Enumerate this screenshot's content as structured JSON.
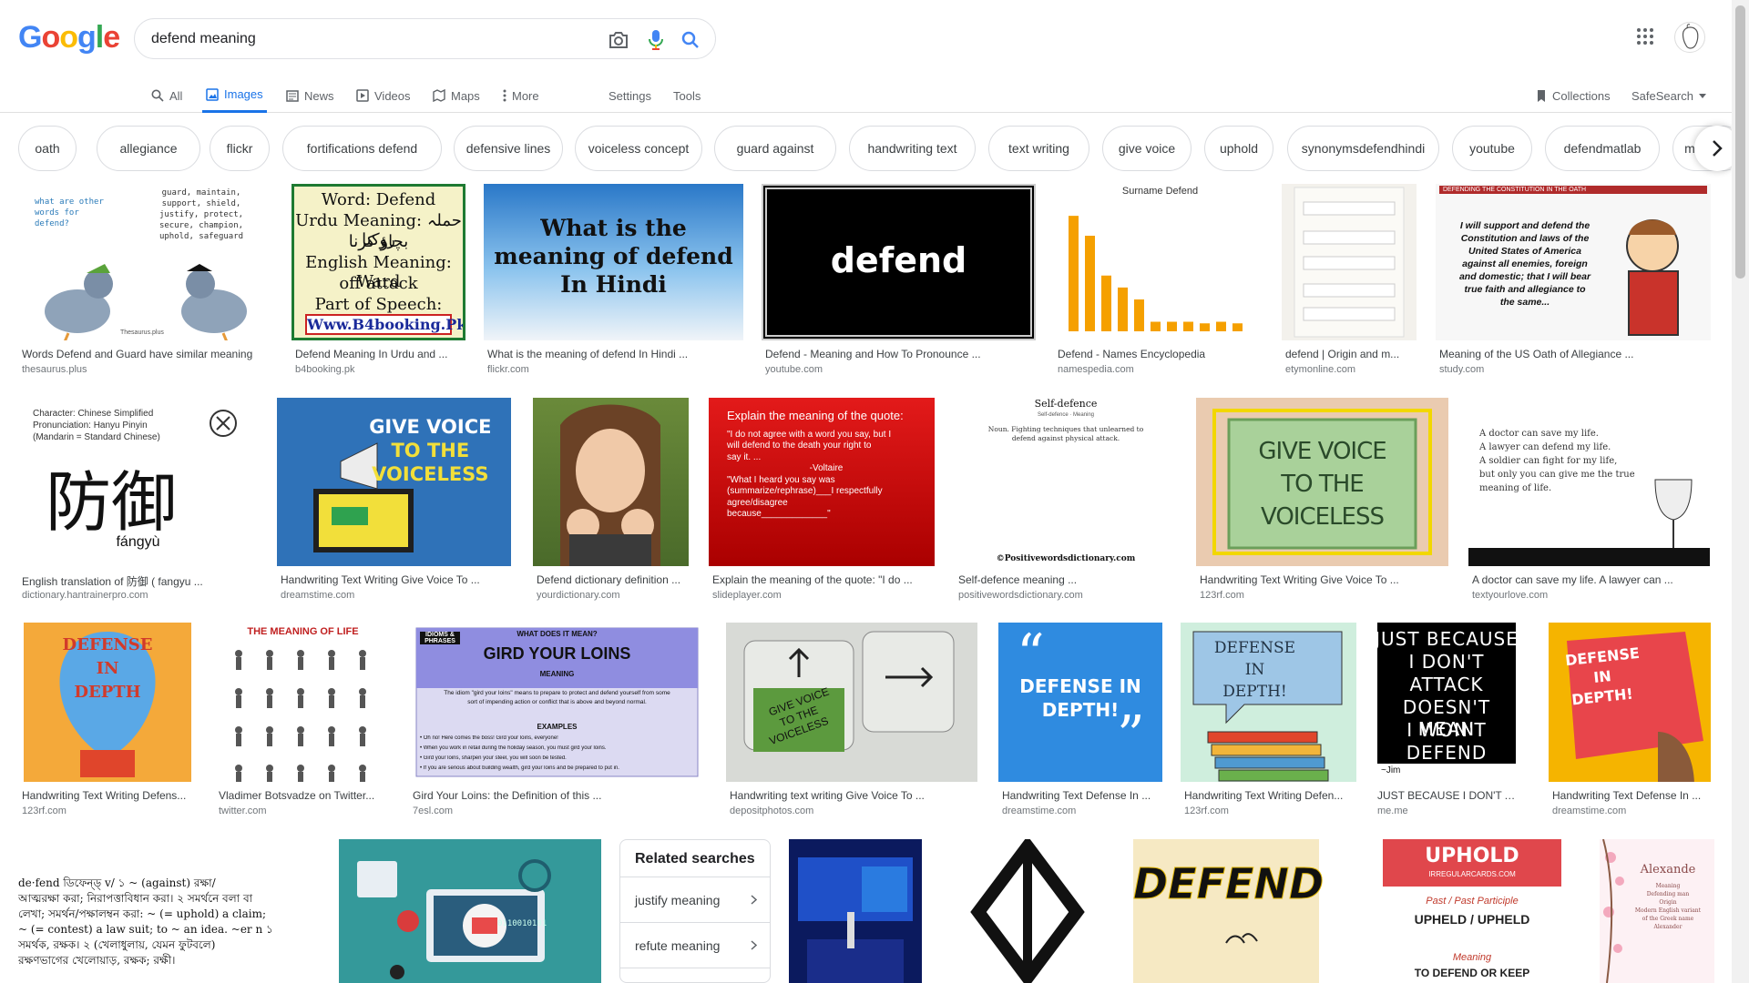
{
  "logo_text": [
    "G",
    "o",
    "o",
    "g",
    "l",
    "e"
  ],
  "logo_colors": [
    "#4285F4",
    "#EA4335",
    "#FBBC05",
    "#4285F4",
    "#34A853",
    "#EA4335"
  ],
  "search": {
    "query": "defend meaning"
  },
  "tabs": {
    "all": "All",
    "images": "Images",
    "news": "News",
    "videos": "Videos",
    "maps": "Maps",
    "more": "More",
    "settings": "Settings",
    "tools": "Tools",
    "collections": "Collections",
    "safesearch": "SafeSearch"
  },
  "chips": [
    "oath",
    "allegiance",
    "flickr",
    "fortifications defend",
    "defensive lines",
    "voiceless concept",
    "guard against",
    "handwriting text",
    "text writing",
    "give voice",
    "uphold",
    "synonymsdefendhindi",
    "youtube",
    "defendmatlab",
    "meaning"
  ],
  "results_row1": [
    {
      "caption": "Words Defend and Guard have similar meaning",
      "domain": "thesaurus.plus",
      "art": "pigeons",
      "img_text": "what are other words for defend?",
      "img_text2": "guard, maintain, support, shield, justify, protect, secure, champion, uphold, safeguard",
      "img_text3": "Thesaurus.plus"
    },
    {
      "caption": "Defend Meaning In Urdu and ...",
      "domain": "b4booking.pk",
      "art": "urdu",
      "lines": [
        "Word: Defend",
        "Urdu Meaning: حملہ روکنا",
        "بچاؤ کرنا",
        "English Meaning: Ward",
        "off attack",
        "Part of Speech: Verb",
        "Www.B4booking.Pk"
      ]
    },
    {
      "caption": "What is the meaning of defend In Hindi ...",
      "domain": "flickr.com",
      "art": "sky",
      "lines": [
        "What is the",
        "meaning of defend",
        "In Hindi"
      ]
    },
    {
      "caption": "Defend - Meaning and How To Pronounce ...",
      "domain": "youtube.com",
      "art": "black",
      "lines": [
        "defend"
      ]
    },
    {
      "caption": "Defend - Names Encyclopedia",
      "domain": "namespedia.com",
      "art": "bars",
      "img_text": "Surname Defend"
    },
    {
      "caption": "defend | Origin and m...",
      "domain": "etymonline.com",
      "art": "phone"
    },
    {
      "caption": "Meaning of the US Oath of Allegiance ...",
      "domain": "study.com",
      "art": "oath",
      "img_text": "DEFENDING THE CONSTITUTION IN THE OATH",
      "lines": [
        "I will support and defend the",
        "Constitution and laws of the",
        "United States of America",
        "against all enemies, foreign",
        "and domestic; that I will bear",
        "true faith and allegiance to",
        "the same..."
      ]
    }
  ],
  "results_row2": [
    {
      "caption": "English translation of 防御 ( fangyu ...",
      "domain": "dictionary.hantrainerpro.com",
      "art": "chinese",
      "lines": [
        "Character: Chinese Simplified",
        "Pronunciation: Hanyu Pinyin",
        "(Mandarin = Standard Chinese)",
        "防御",
        "fángyù"
      ]
    },
    {
      "caption": "Handwriting Text Writing Give Voice To ...",
      "domain": "dreamstime.com",
      "art": "voice-blue",
      "lines": [
        "GIVE VOICE",
        "TO THE",
        "VOICELESS"
      ]
    },
    {
      "caption": "Defend dictionary definition ...",
      "domain": "yourdictionary.com",
      "art": "girl"
    },
    {
      "caption": "Explain the meaning of the quote: \"I do ...",
      "domain": "slideplayer.com",
      "art": "red",
      "lines": [
        "Explain the meaning of the quote:",
        "\"I do not agree with a word you say, but I",
        "will defend to the death your right to",
        "say it. ...",
        "-Voltaire",
        "\"What I heard you say was",
        "(summarize/rephrase)___I respectfully",
        "agree/disagree",
        "because_____________\""
      ]
    },
    {
      "caption": "Self-defence meaning ...",
      "domain": "positivewordsdictionary.com",
      "art": "selfdef",
      "lines": [
        "Self-defence",
        "Self-defence · Meaning",
        "Noun. Fighting techniques that unlearned to",
        "defend against physical attack.",
        "©Positivewordsdictionary.com"
      ]
    },
    {
      "caption": "Handwriting Text Writing Give Voice To ...",
      "domain": "123rf.com",
      "art": "voice-green",
      "lines": [
        "GIVE VOICE",
        "TO THE",
        "VOICELESS"
      ]
    },
    {
      "caption": "A doctor can save my life. A lawyer can ...",
      "domain": "textyourlove.com",
      "art": "doctor",
      "lines": [
        "A doctor can save my life.",
        "A lawyer can defend my life.",
        "A soldier can fight for my life,",
        "but only you can give me the true",
        "meaning of life."
      ]
    }
  ],
  "results_row3": [
    {
      "caption": "Handwriting Text Writing Defens...",
      "domain": "123rf.com",
      "art": "balloon",
      "lines": [
        "DEFENSE",
        "IN",
        "DEPTH"
      ]
    },
    {
      "caption": "Vladimer Botsvadze on Twitter...",
      "domain": "twitter.com",
      "art": "life",
      "lines": [
        "THE MEANING OF LIFE"
      ]
    },
    {
      "caption": "Gird Your Loins: the Definition of this ...",
      "domain": "7esl.com",
      "art": "loins",
      "lines": [
        "IDIOMS & PHRASES",
        "WHAT DOES IT MEAN?",
        "GIRD YOUR LOINS",
        "MEANING",
        "The idiom \"gird your loins\" means to prepare to protect and defend yourself from some",
        "sort of impending action or conflict that is above and beyond normal.",
        "EXAMPLES",
        "Oh no! Here comes the boss! Gird your loins, everyone!",
        "When you work in retail during the holiday season, you must gird your loins.",
        "Gird your loins, sharpen your steel, you will soon be tested.",
        "If you are serious about building wealth, gird your loins and be prepared to put in."
      ]
    },
    {
      "caption": "Handwriting text writing Give Voice To ...",
      "domain": "depositphotos.com",
      "art": "keyboard",
      "lines": [
        "GIVE VOICE",
        "TO THE",
        "VOICELESS"
      ]
    },
    {
      "caption": "Handwriting Text Defense In ...",
      "domain": "dreamstime.com",
      "art": "quote-blue",
      "lines": [
        "DEFENSE IN",
        "DEPTH!"
      ]
    },
    {
      "caption": "Handwriting Text Writing Defen...",
      "domain": "123rf.com",
      "art": "books",
      "lines": [
        "DEFENSE",
        "IN",
        "DEPTH!"
      ]
    },
    {
      "caption": "JUST BECAUSE I DON'T A...",
      "domain": "me.me",
      "art": "attack",
      "lines": [
        "JUST BECAUSE",
        "I DON'T",
        "ATTACK",
        "DOESN'T MEAN",
        "I WON'T",
        "DEFEND",
        "~Jim"
      ]
    },
    {
      "caption": "Handwriting Text Defense In ...",
      "domain": "dreamstime.com",
      "art": "card-red",
      "lines": [
        "DEFENSE",
        "IN",
        "DEPTH!"
      ]
    }
  ],
  "row4": {
    "bengali_lines": [
      "de·fend ডিফেন্ড্‌ v/ ১ ~ (against) রক্ষা/",
      "আত্মরক্ষা করা; নিরাপত্তাবিধান করা। ২ সমর্থনে বলা বা",
      "লেখা; সমর্থন/পক্ষালম্বন করা: ~ (= uphold) a claim;",
      "~ (= contest) a law suit; to ~ an idea. ~er n ১",
      "সমর্থক, রক্ষক। ২ (খেলাধুলায়, যেমন ফুটবলে)",
      "রক্ষণভাগের খেলোয়াড়, রক্ষক; রক্ষী।"
    ],
    "related_title": "Related searches",
    "related_items": [
      "justify meaning",
      "refute meaning"
    ],
    "defend_word": "DEFEND",
    "uphold_lines": [
      "UPHOLD",
      "IRREGULARCARDS.COM",
      "Past / Past Participle",
      "UPHELD / UPHELD",
      "Meaning",
      "TO DEFEND OR KEEP"
    ],
    "alexande_lines": [
      "Alexande",
      "Meaning",
      "Defending man",
      "Origin",
      "Modern English variant",
      "of the Greek name",
      "Alexander"
    ]
  }
}
